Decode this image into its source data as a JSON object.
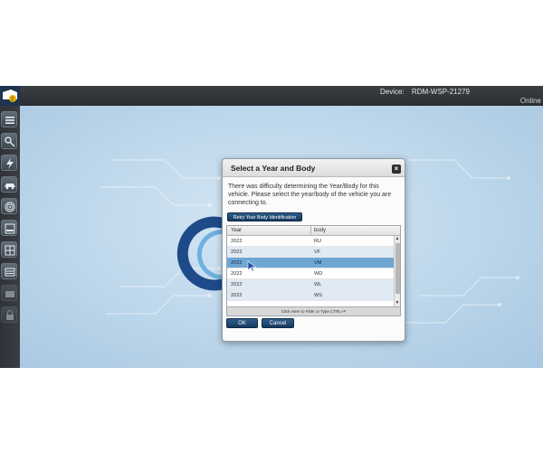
{
  "header": {
    "device_label": "Device:",
    "device_value": "RDM-WSP-21279",
    "status": "Online"
  },
  "sidebar": {
    "items": [
      {
        "name": "menu-icon"
      },
      {
        "name": "vehicle-search-icon"
      },
      {
        "name": "flash-icon"
      },
      {
        "name": "vehicle-icon"
      },
      {
        "name": "fingerprint-icon"
      },
      {
        "name": "reports-icon"
      },
      {
        "name": "layout-icon"
      },
      {
        "name": "list-icon"
      },
      {
        "name": "tools-icon"
      },
      {
        "name": "lock-icon"
      }
    ]
  },
  "dialog": {
    "title": "Select a Year and Body",
    "close_label": "×",
    "message": "There was difficulty determining the Year/Body for this vehicle. Please select the year/body of the vehicle you are connecting to.",
    "retry_button": "Retry Year Body Identification",
    "grid": {
      "columns": [
        "Year",
        "body"
      ],
      "rows": [
        {
          "year": "2022",
          "body": "RU"
        },
        {
          "year": "2022",
          "body": "VF"
        },
        {
          "year": "2022",
          "body": "VM",
          "selected": true
        },
        {
          "year": "2022",
          "body": "WD"
        },
        {
          "year": "2022",
          "body": "WL"
        },
        {
          "year": "2022",
          "body": "WS"
        }
      ],
      "filter_hint": "Click Here to Filter or Type CTRL+F"
    },
    "ok_button": "OK",
    "cancel_button": "Cancel"
  },
  "colors": {
    "accent": "#1f4a74",
    "selection": "#6ea6d4",
    "topbar": "#2f3338"
  }
}
